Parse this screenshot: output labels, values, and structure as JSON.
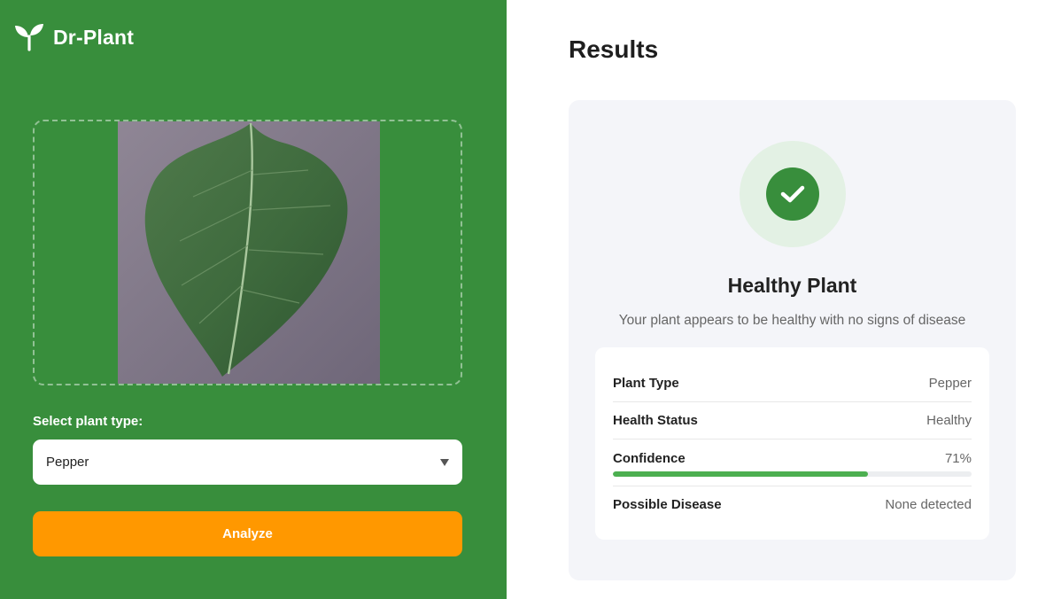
{
  "brand": {
    "name": "Dr-Plant",
    "icon": "sprout-icon"
  },
  "upload": {
    "image": "pepper-leaf-photo"
  },
  "plant_select": {
    "label": "Select plant type:",
    "value": "Pepper"
  },
  "actions": {
    "analyze_label": "Analyze"
  },
  "results": {
    "title": "Results",
    "status_icon": "check-circle-icon",
    "heading": "Healthy Plant",
    "description": "Your plant appears to be healthy with no signs of disease",
    "details": {
      "plant_type": {
        "label": "Plant Type",
        "value": "Pepper"
      },
      "health_status": {
        "label": "Health Status",
        "value": "Healthy"
      },
      "confidence": {
        "label": "Confidence",
        "value": "71%",
        "fraction": 0.71
      },
      "possible_disease": {
        "label": "Possible Disease",
        "value": "None detected"
      }
    }
  },
  "colors": {
    "primary_green": "#388e3c",
    "accent_orange": "#ff9800",
    "progress_green": "#4caf50",
    "success_light": "#e3f1e4"
  }
}
